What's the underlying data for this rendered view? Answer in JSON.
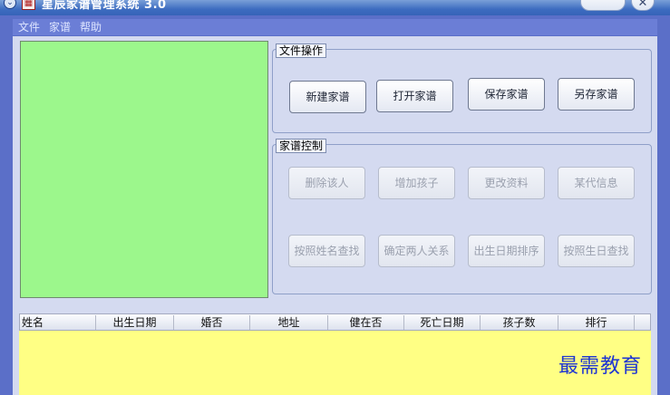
{
  "window": {
    "title": "星辰家谱管理系统 3.0",
    "close_glyph": "✕"
  },
  "menu": {
    "items": [
      "文件",
      "家谱",
      "帮助"
    ]
  },
  "file_ops": {
    "title": "文件操作",
    "buttons": [
      "新建家谱",
      "打开家谱",
      "保存家谱",
      "另存家谱"
    ]
  },
  "tree_ctrl": {
    "title": "家谱控制",
    "buttons_row1": [
      "删除该人",
      "增加孩子",
      "更改资料",
      "某代信息"
    ],
    "buttons_row2": [
      "按照姓名查找",
      "确定两人关系",
      "出生日期排序",
      "按照生日查找"
    ]
  },
  "table": {
    "columns": [
      "姓名",
      "出生日期",
      "婚否",
      "地址",
      "健在否",
      "死亡日期",
      "孩子数",
      "排行"
    ]
  },
  "watermark": "最需教育",
  "colors": {
    "tree_panel": "#9cf78c",
    "list_body": "#ffff84",
    "window_frame": "#5b6fc8"
  }
}
